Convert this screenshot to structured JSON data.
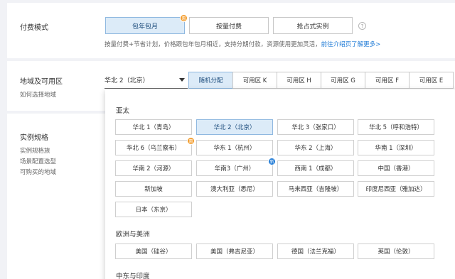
{
  "billing": {
    "label": "付费模式",
    "options": [
      {
        "label": "包年包月",
        "badge": "惠"
      },
      {
        "label": "按量付费"
      },
      {
        "label": "抢占式实例"
      }
    ],
    "help": "?",
    "desc_text": "按量付费+节省计划，价格跟包年包月相近，支持分期付款，资源使用更加灵活，",
    "desc_link": "前往介绍页了解更多>"
  },
  "region": {
    "label": "地域及可用区",
    "sub": "如何选择地域",
    "selected": "华北 2（北京）",
    "zones": [
      "随机分配",
      "可用区 K",
      "可用区 H",
      "可用区 G",
      "可用区 F",
      "可用区 E"
    ]
  },
  "spec": {
    "label": "实例规格",
    "links": [
      "实例规格族",
      "场景配置选型",
      "可购买的地域"
    ]
  },
  "dropdown": {
    "groups": [
      {
        "title": "亚太",
        "cities": [
          {
            "label": "华北 1（青岛）"
          },
          {
            "label": "华北 2（北京）",
            "selected": true
          },
          {
            "label": "华北 3（张家口）"
          },
          {
            "label": "华北 5（呼和浩特）"
          },
          {
            "label": "华北 6（乌兰察布）",
            "badge": "惠"
          },
          {
            "label": "华东 1（杭州）"
          },
          {
            "label": "华东 2（上海）"
          },
          {
            "label": "华南 1（深圳）"
          },
          {
            "label": "华南 2（河源）"
          },
          {
            "label": "华南3（广州）",
            "badge": "新"
          },
          {
            "label": "西南 1（成都）"
          },
          {
            "label": "中国（香港）"
          },
          {
            "label": "新加坡"
          },
          {
            "label": "澳大利亚（悉尼）"
          },
          {
            "label": "马来西亚（吉隆坡）"
          },
          {
            "label": "印度尼西亚（雅加达）"
          },
          {
            "label": "日本（东京）"
          }
        ]
      },
      {
        "title": "欧洲与美洲",
        "cities": [
          {
            "label": "美国（硅谷）"
          },
          {
            "label": "美国（弗吉尼亚）"
          },
          {
            "label": "德国（法兰克福）"
          },
          {
            "label": "英国（伦敦）"
          }
        ]
      },
      {
        "title": "中东与印度",
        "cities": []
      }
    ]
  }
}
